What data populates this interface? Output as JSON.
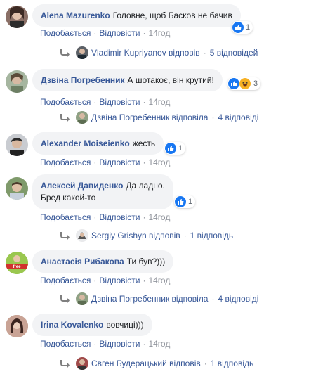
{
  "comments": [
    {
      "author": "Alena Mazurenko",
      "text": "Головне, щоб Басков не бачив",
      "reaction_count": "1",
      "like_label": "Подобається",
      "reply_label": "Відповісти",
      "time": "14год",
      "reply": {
        "who": "Vladimir Kupriyanov відповів",
        "count": "5 відповідей"
      }
    },
    {
      "author": "Дзвіна Погребенник",
      "text": "А шотакоє, він крутий!",
      "reaction_count": "3",
      "like_label": "Подобається",
      "reply_label": "Відповісти",
      "time": "14год",
      "reply": {
        "who": "Дзвіна Погребенник відповіла",
        "count": "4 відповіді"
      }
    },
    {
      "author": "Alexander Moiseienko",
      "text": "жесть",
      "reaction_count": "1",
      "like_label": "Подобається",
      "reply_label": "Відповісти",
      "time": "14год"
    },
    {
      "author": "Алексей Давиденко",
      "text": "Да ладно.",
      "text2": "Бред какой-то",
      "reaction_count": "1",
      "like_label": "Подобається",
      "reply_label": "Відповісти",
      "time": "14год",
      "reply": {
        "who": "Sergiy Grishyn відповів",
        "count": "1 відповідь"
      }
    },
    {
      "author": "Анастасія Рибакова",
      "text": "Ти був?)))",
      "like_label": "Подобається",
      "reply_label": "Відповісти",
      "time": "14год",
      "reply": {
        "who": "Дзвіна Погребенник відповіла",
        "count": "4 відповіді"
      }
    },
    {
      "author": "Irina Kovalenko",
      "text": "вовчиці)))",
      "like_label": "Подобається",
      "reply_label": "Відповісти",
      "time": "14год",
      "reply": {
        "who": "Євген Будерацький відповів",
        "count": "1 відповідь"
      }
    }
  ],
  "colors": {
    "link": "#385898",
    "bubble": "#f2f3f5",
    "like": "#1877f2",
    "haha": "#f7b125"
  }
}
